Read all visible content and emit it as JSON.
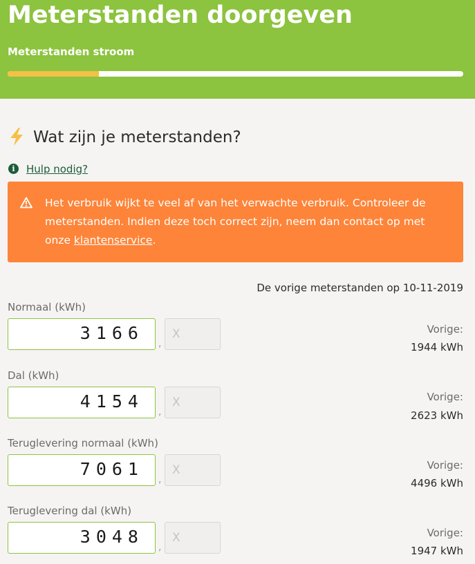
{
  "header": {
    "title": "Meterstanden doorgeven",
    "step_label": "Meterstanden stroom",
    "progress_percent": 20,
    "accent_color": "#8cc33f",
    "progress_color": "#f5c048"
  },
  "question": {
    "icon": "lightning-icon",
    "title": "Wat zijn je meterstanden?"
  },
  "help": {
    "icon": "info-icon",
    "label": "Hulp nodig?"
  },
  "alert": {
    "icon": "warning-triangle-icon",
    "color": "#fd8439",
    "text_before": "Het verbruik wijkt te veel af van het verwachte verbruik. Controleer de meterstanden. Indien deze toch correct zijn, neem dan contact op met onze ",
    "link_text": "klantenservice",
    "text_after": "."
  },
  "previous_heading": "De vorige meterstanden op 10-11-2019",
  "fields": [
    {
      "label": "Normaal (kWh)",
      "value": "3166",
      "decimal_placeholder": "X",
      "separator": ",",
      "prev_label": "Vorige:",
      "prev_value": "1944 kWh"
    },
    {
      "label": "Dal (kWh)",
      "value": "4154",
      "decimal_placeholder": "X",
      "separator": ",",
      "prev_label": "Vorige:",
      "prev_value": "2623 kWh"
    },
    {
      "label": "Teruglevering normaal (kWh)",
      "value": "7061",
      "decimal_placeholder": "X",
      "separator": ",",
      "prev_label": "Vorige:",
      "prev_value": "4496 kWh"
    },
    {
      "label": "Teruglevering dal (kWh)",
      "value": "3048",
      "decimal_placeholder": "X",
      "separator": ",",
      "prev_label": "Vorige:",
      "prev_value": "1947 kWh"
    }
  ]
}
